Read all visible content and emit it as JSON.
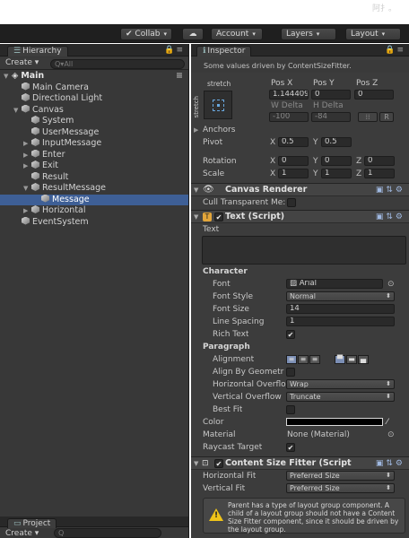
{
  "corner_text": "阿扌。",
  "toolbar": {
    "collab_label": "Collab",
    "cloud_icon": "cloud-icon",
    "account_label": "Account",
    "layers_label": "Layers",
    "layout_label": "Layout"
  },
  "hierarchy": {
    "tab_label": "Hierarchy",
    "create_label": "Create",
    "search_placeholder": "Q▾All",
    "rows": [
      {
        "label": "Main",
        "indent": 0,
        "fold": "▼",
        "scene": true
      },
      {
        "label": "Main Camera",
        "indent": 1,
        "fold": ""
      },
      {
        "label": "Directional Light",
        "indent": 1,
        "fold": ""
      },
      {
        "label": "Canvas",
        "indent": 1,
        "fold": "▼"
      },
      {
        "label": "System",
        "indent": 2,
        "fold": ""
      },
      {
        "label": "UserMessage",
        "indent": 2,
        "fold": ""
      },
      {
        "label": "InputMessage",
        "indent": 2,
        "fold": "▶"
      },
      {
        "label": "Enter",
        "indent": 2,
        "fold": "▶"
      },
      {
        "label": "Exit",
        "indent": 2,
        "fold": "▶"
      },
      {
        "label": "Result",
        "indent": 2,
        "fold": ""
      },
      {
        "label": "ResultMessage",
        "indent": 2,
        "fold": "▼"
      },
      {
        "label": "Message",
        "indent": 3,
        "fold": "",
        "selected": true
      },
      {
        "label": "Horizontal",
        "indent": 2,
        "fold": "▶"
      },
      {
        "label": "EventSystem",
        "indent": 1,
        "fold": ""
      }
    ]
  },
  "project": {
    "tab_label": "Project",
    "create_label": "Create"
  },
  "inspector": {
    "tab_label": "Inspector",
    "driven_note": "Some values driven by ContentSizeFitter.",
    "stretch_label": "stretch",
    "stretch_side_label": "stretch",
    "pos_headers": [
      "Pos X",
      "Pos Y",
      "Pos Z"
    ],
    "pos_values": [
      "1.144409",
      "0",
      "0"
    ],
    "size_headers": [
      "W Delta",
      "H Delta"
    ],
    "size_values": [
      "-100",
      "-84"
    ],
    "r_button": "R",
    "anchors_label": "Anchors",
    "pivot_label": "Pivot",
    "pivot_x": "0.5",
    "pivot_y": "0.5",
    "rotation_label": "Rotation",
    "rotation": [
      "0",
      "0",
      "0"
    ],
    "scale_label": "Scale",
    "scale": [
      "1",
      "1",
      "1"
    ],
    "axis_x": "X",
    "axis_y": "Y",
    "axis_z": "Z",
    "canvas_renderer_title": "Canvas Renderer",
    "cull_label": "Cull Transparent Me:",
    "text_script_title": "Text (Script)",
    "text_label": "Text",
    "character_label": "Character",
    "font_label": "Font",
    "font_value": "Arial",
    "font_style_label": "Font Style",
    "font_style_value": "Normal",
    "font_size_label": "Font Size",
    "font_size_value": "14",
    "line_spacing_label": "Line Spacing",
    "line_spacing_value": "1",
    "rich_text_label": "Rich Text",
    "paragraph_label": "Paragraph",
    "alignment_label": "Alignment",
    "align_by_geometry_label": "Align By Geometr",
    "h_overflow_label": "Horizontal Overflo",
    "h_overflow_value": "Wrap",
    "v_overflow_label": "Vertical Overflow",
    "v_overflow_value": "Truncate",
    "best_fit_label": "Best Fit",
    "color_label": "Color",
    "material_label": "Material",
    "material_value": "None (Material)",
    "raycast_label": "Raycast Target",
    "csf_title": "Content Size Fitter (Script",
    "h_fit_label": "Horizontal Fit",
    "h_fit_value": "Preferred Size",
    "v_fit_label": "Vertical Fit",
    "v_fit_value": "Preferred Size",
    "warning_text": "Parent has a type of layout group component. A child of a layout group should not have a Content Size Fitter component, since it should be driven by the layout group.",
    "colors": {
      "accent": "#3e5f96",
      "warning": "#f0c419"
    }
  }
}
